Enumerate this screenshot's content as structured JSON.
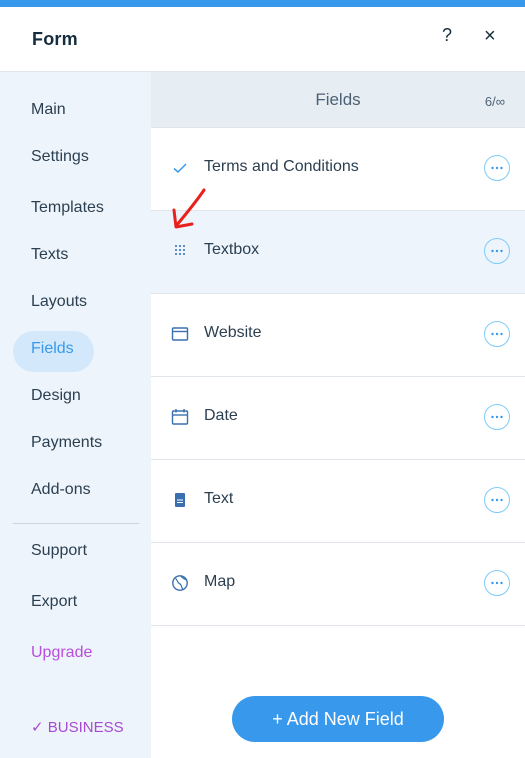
{
  "app": {
    "title": "Form",
    "help_label": "?",
    "close_label": "×"
  },
  "colors": {
    "accent": "#3899ec",
    "sidebar_bg": "#eef4fb",
    "selected_row_bg": "#edf4fc",
    "upgrade": "#b84fdb",
    "annotation": "#e8211d"
  },
  "sidebar": {
    "items": [
      {
        "label": "Main"
      },
      {
        "label": "Settings"
      },
      {
        "label": "Templates"
      },
      {
        "label": "Texts"
      },
      {
        "label": "Layouts"
      },
      {
        "label": "Fields",
        "active": true
      },
      {
        "label": "Design"
      },
      {
        "label": "Payments"
      },
      {
        "label": "Add-ons"
      }
    ],
    "bottom_items": [
      {
        "label": "Support"
      },
      {
        "label": "Export"
      },
      {
        "label": "Upgrade"
      }
    ],
    "plan_badge": "✓ BUSINESS"
  },
  "fields_panel": {
    "title": "Fields",
    "count": "6/∞",
    "fields": [
      {
        "label": "Terms and Conditions",
        "icon": "checkmark-icon"
      },
      {
        "label": "Textbox",
        "icon": "grid-dots-icon",
        "selected": true
      },
      {
        "label": "Website",
        "icon": "browser-window-icon"
      },
      {
        "label": "Date",
        "icon": "calendar-icon"
      },
      {
        "label": "Text",
        "icon": "text-block-icon"
      },
      {
        "label": "Map",
        "icon": "globe-icon"
      }
    ],
    "add_button_label": "+ Add New Field"
  },
  "annotation": {
    "icon": "red-arrow-annotation-icon"
  }
}
